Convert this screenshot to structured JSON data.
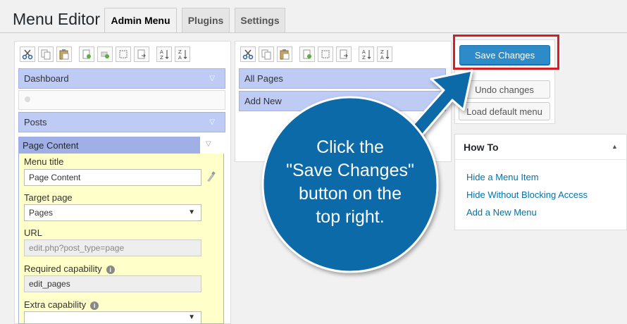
{
  "page": {
    "title": "Menu Editor",
    "tabs": [
      {
        "label": "Admin Menu",
        "active": true
      },
      {
        "label": "Plugins",
        "active": false
      },
      {
        "label": "Settings",
        "active": false
      }
    ]
  },
  "toolbar_icons": [
    "cut-icon",
    "copy-icon",
    "paste-icon",
    "new-item-icon",
    "new-separator-icon",
    "new-submenu-icon",
    "hide-icon",
    "sort-ascending-icon",
    "sort-descending-icon"
  ],
  "left_menu": {
    "items": [
      {
        "label": "Dashboard"
      },
      {
        "label": "Posts"
      },
      {
        "label": "Page Content"
      }
    ]
  },
  "editor": {
    "menu_title_label": "Menu title",
    "menu_title_value": "Page Content",
    "target_page_label": "Target page",
    "target_page_value": "Pages",
    "url_label": "URL",
    "url_value": "edit.php?post_type=page",
    "required_capability_label": "Required capability",
    "required_capability_value": "edit_pages",
    "extra_capability_label": "Extra capability",
    "extra_capability_value": ""
  },
  "submenu": {
    "items": [
      {
        "label": "All Pages"
      },
      {
        "label": "Add New"
      }
    ]
  },
  "actions": {
    "save": "Save Changes",
    "undo": "Undo changes",
    "load_default": "Load default menu"
  },
  "howto": {
    "title": "How To",
    "links": [
      "Hide a Menu Item",
      "Hide Without Blocking Access",
      "Add a New Menu"
    ]
  },
  "callout": {
    "line1": "Click the",
    "line2": "\"Save Changes\"",
    "line3": "button on the",
    "line4": "top right.",
    "color": "#0e6aa8",
    "highlight_color": "#d42025"
  }
}
